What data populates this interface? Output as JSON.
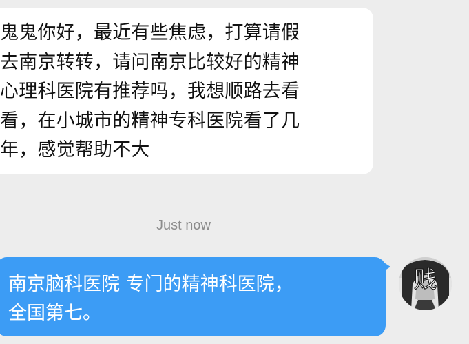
{
  "incoming_message": {
    "text": "鬼鬼你好，最近有些焦虑，打算请假\n去南京转转，请问南京比较好的精神\n心理科医院有推荐吗，我想顺路去看\n看，在小城市的精神专科医院看了几\n年，感觉帮助不大"
  },
  "timestamp": "Just now",
  "outgoing_message": {
    "text": "南京脑科医院 专门的精神科医院，\n全国第七。"
  },
  "avatar": {
    "glyph": "贱",
    "icon": "user-avatar-icon"
  },
  "colors": {
    "background": "#ededed",
    "incoming_bubble": "#ffffff",
    "outgoing_bubble": "#3c9cf5",
    "timestamp": "#8c8c8c"
  }
}
